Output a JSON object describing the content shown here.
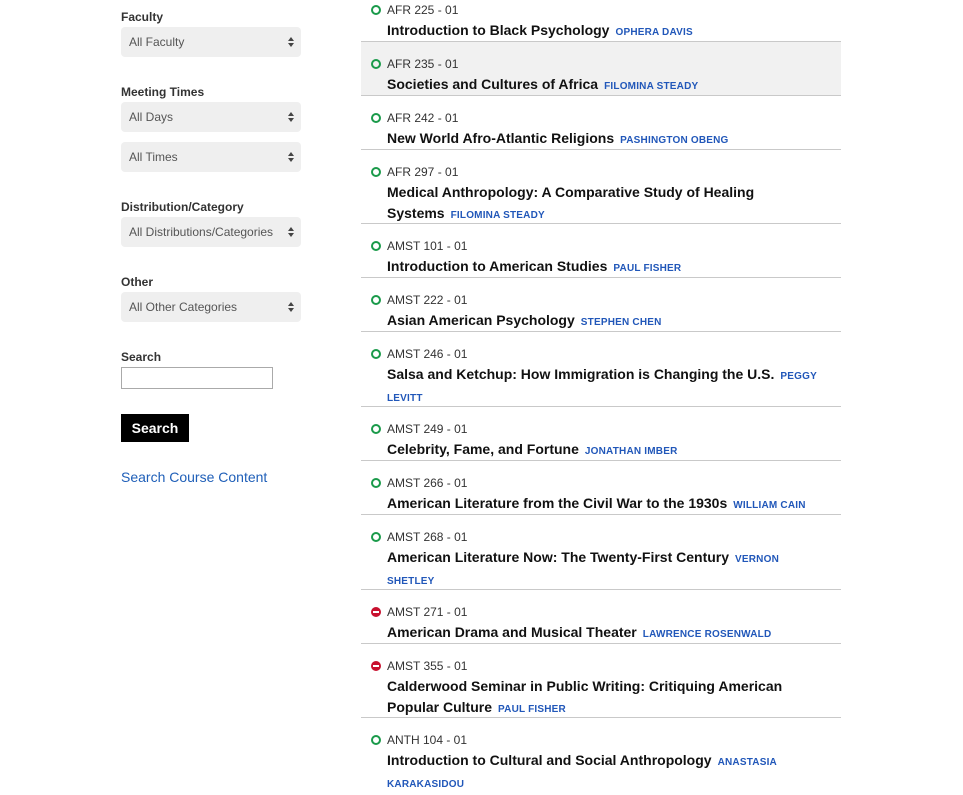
{
  "filters": {
    "faculty": {
      "label": "Faculty",
      "value": "All Faculty"
    },
    "meeting_times": {
      "label": "Meeting Times",
      "days_value": "All Days",
      "times_value": "All Times"
    },
    "distribution": {
      "label": "Distribution/Category",
      "value": "All Distributions/Categories"
    },
    "other": {
      "label": "Other",
      "value": "All Other Categories"
    },
    "search": {
      "label": "Search",
      "input_value": "",
      "button_label": "Search"
    },
    "content_link": "Search Course Content"
  },
  "colors": {
    "open": "#1a9a4a",
    "closed": "#c8102e",
    "link": "#2157b9"
  },
  "courses": [
    {
      "code": "AFR 225 - 01",
      "title": "Introduction to Black Psychology",
      "professor": "OPHERA DAVIS",
      "status": "open"
    },
    {
      "code": "AFR 235 - 01",
      "title": "Societies and Cultures of Africa",
      "professor": "FILOMINA STEADY",
      "status": "open"
    },
    {
      "code": "AFR 242 - 01",
      "title": "New World Afro-Atlantic Religions",
      "professor": "PASHINGTON OBENG",
      "status": "open"
    },
    {
      "code": "AFR 297 - 01",
      "title": "Medical Anthropology: A Comparative Study of Healing Systems",
      "professor": "FILOMINA STEADY",
      "status": "open"
    },
    {
      "code": "AMST 101 - 01",
      "title": "Introduction to American Studies",
      "professor": "PAUL FISHER",
      "status": "open"
    },
    {
      "code": "AMST 222 - 01",
      "title": "Asian American Psychology",
      "professor": "STEPHEN CHEN",
      "status": "open"
    },
    {
      "code": "AMST 246 - 01",
      "title": "Salsa and Ketchup: How Immigration is Changing the U.S.",
      "professor": "PEGGY LEVITT",
      "status": "open"
    },
    {
      "code": "AMST 249 - 01",
      "title": "Celebrity, Fame, and Fortune",
      "professor": "JONATHAN IMBER",
      "status": "open"
    },
    {
      "code": "AMST 266 - 01",
      "title": "American Literature from the Civil War to the 1930s",
      "professor": "WILLIAM CAIN",
      "status": "open"
    },
    {
      "code": "AMST 268 - 01",
      "title": "American Literature Now: The Twenty-First Century",
      "professor": "VERNON SHETLEY",
      "status": "open"
    },
    {
      "code": "AMST 271 - 01",
      "title": "American Drama and Musical Theater",
      "professor": "LAWRENCE ROSENWALD",
      "status": "closed"
    },
    {
      "code": "AMST 355 - 01",
      "title": "Calderwood Seminar in Public Writing: Critiquing American Popular Culture",
      "professor": "PAUL FISHER",
      "status": "closed"
    },
    {
      "code": "ANTH 104 - 01",
      "title": "Introduction to Cultural and Social Anthropology",
      "professor": "ANASTASIA KARAKASIDOU",
      "status": "open"
    }
  ]
}
